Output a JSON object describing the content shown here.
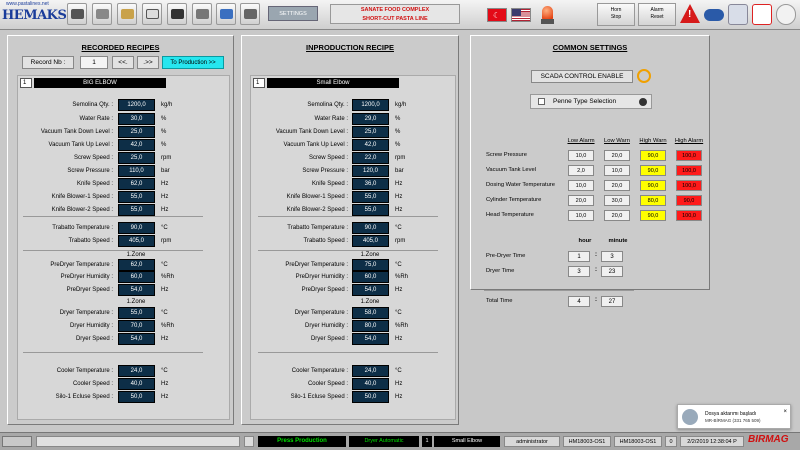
{
  "header": {
    "url": "www.pastalines.net",
    "brand": "HEMAKS",
    "settings_label": "SETTINGS",
    "complex_line1": "SANATE FOOD COMPLEX",
    "complex_line2": "SHORT-CUT PASTA  LINE",
    "horn_label1": "Horn",
    "horn_label2": "Stop",
    "alarm_label1": "Alarm",
    "alarm_label2": "Reset",
    "warn_glyph": "!"
  },
  "recorded": {
    "title": "RECORDED RECIPES",
    "record_label": "Record Nb :",
    "record_value": "1",
    "prev_label": "<<.",
    "next_label": ".>>",
    "to_production": "To Production >>",
    "index": "1",
    "name": "BIG ELBOW",
    "rows": [
      {
        "label": "Semolina Qty. :",
        "value": "1200,0",
        "unit": "kg/h"
      },
      {
        "label": "Water Rate :",
        "value": "30,0",
        "unit": "%"
      },
      {
        "label": "Vacuum Tank Down Level :",
        "value": "25,0",
        "unit": "%"
      },
      {
        "label": "Vacuum Tank Up Level :",
        "value": "42,0",
        "unit": "%"
      },
      {
        "label": "Screw Speed :",
        "value": "25,0",
        "unit": "rpm"
      },
      {
        "label": "Screw Pressure :",
        "value": "110,0",
        "unit": "bar"
      },
      {
        "label": "Knife Speed :",
        "value": "62,0",
        "unit": "Hz"
      },
      {
        "label": "Knife Blower-1 Speed :",
        "value": "55,0",
        "unit": "Hz"
      },
      {
        "label": "Knife Blower-2 Speed :",
        "value": "55,0",
        "unit": "Hz"
      },
      {
        "label": "Trabatto Temperature :",
        "value": "90,0",
        "unit": "°C"
      },
      {
        "label": "Trabatto Speed :",
        "value": "405,0",
        "unit": "rpm"
      },
      {
        "label": "PreDryer Temperature :",
        "value": "62,0",
        "unit": "°C"
      },
      {
        "label": "PreDryer Humidity :",
        "value": "60,0",
        "unit": "%Rh"
      },
      {
        "label": "PreDryer Speed :",
        "value": "54,0",
        "unit": "Hz"
      },
      {
        "label": "Dryer Temperature :",
        "value": "55,0",
        "unit": "°C"
      },
      {
        "label": "Dryer Humidity :",
        "value": "70,0",
        "unit": "%Rh"
      },
      {
        "label": "Dryer Speed :",
        "value": "54,0",
        "unit": "Hz"
      },
      {
        "label": "Cooler Temperature :",
        "value": "24,0",
        "unit": "°C"
      },
      {
        "label": "Cooler Speed :",
        "value": "40,0",
        "unit": "Hz"
      },
      {
        "label": "Silo-1 Ecluse Speed :",
        "value": "50,0",
        "unit": "Hz"
      }
    ],
    "zone1": "1.Zone",
    "zone2": "1.Zone"
  },
  "production": {
    "title": "INPRODUCTION RECIPE",
    "index": "1",
    "name": "Small Elbow",
    "rows": [
      {
        "label": "Semolina Qty. :",
        "value": "1200,0",
        "unit": "kg/h"
      },
      {
        "label": "Water Rate :",
        "value": "29,0",
        "unit": "%"
      },
      {
        "label": "Vacuum Tank Down Level :",
        "value": "25,0",
        "unit": "%"
      },
      {
        "label": "Vacuum Tank Up Level :",
        "value": "42,0",
        "unit": "%"
      },
      {
        "label": "Screw Speed :",
        "value": "22,0",
        "unit": "rpm"
      },
      {
        "label": "Screw Pressure :",
        "value": "120,0",
        "unit": "bar"
      },
      {
        "label": "Knife Speed :",
        "value": "36,0",
        "unit": "Hz"
      },
      {
        "label": "Knife Blower-1 Speed :",
        "value": "55,0",
        "unit": "Hz"
      },
      {
        "label": "Knife Blower-2 Speed :",
        "value": "55,0",
        "unit": "Hz"
      },
      {
        "label": "Trabatto Temperature :",
        "value": "90,0",
        "unit": "°C"
      },
      {
        "label": "Trabatto Speed :",
        "value": "405,0",
        "unit": "rpm"
      },
      {
        "label": "PreDryer Temperature :",
        "value": "75,0",
        "unit": "°C"
      },
      {
        "label": "PreDryer Humidity :",
        "value": "60,0",
        "unit": "%Rh"
      },
      {
        "label": "PreDryer Speed :",
        "value": "54,0",
        "unit": "Hz"
      },
      {
        "label": "Dryer Temperature :",
        "value": "58,0",
        "unit": "°C"
      },
      {
        "label": "Dryer Humidity :",
        "value": "80,0",
        "unit": "%Rh"
      },
      {
        "label": "Dryer Speed :",
        "value": "54,0",
        "unit": "Hz"
      },
      {
        "label": "Cooler Temperature :",
        "value": "24,0",
        "unit": "°C"
      },
      {
        "label": "Cooler Speed :",
        "value": "40,0",
        "unit": "Hz"
      },
      {
        "label": "Silo-1 Ecluse Speed :",
        "value": "50,0",
        "unit": "Hz"
      }
    ],
    "zone1": "1.Zone",
    "zone2": "1.Zone"
  },
  "common": {
    "title": "COMMON SETTINGS",
    "scada_label": "SCADA CONTROL ENABLE",
    "penne_label": "Penne Type Selection",
    "headers": [
      "Low Alarm",
      "Low Warn",
      "High Warn",
      "High Alarm"
    ],
    "rows": [
      {
        "label": "Screw Pressure",
        "values": [
          "10,0",
          "20,0",
          "90,0",
          "100,0"
        ]
      },
      {
        "label": "Vacuum Tank Level",
        "values": [
          "2,0",
          "10,0",
          "90,0",
          "100,0"
        ]
      },
      {
        "label": "Dosing Water Temperature",
        "values": [
          "10,0",
          "20,0",
          "90,0",
          "100,0"
        ]
      },
      {
        "label": "Cylinder Temperature",
        "values": [
          "20,0",
          "30,0",
          "80,0",
          "90,0"
        ]
      },
      {
        "label": "Head Temperature",
        "values": [
          "10,0",
          "20,0",
          "90,0",
          "100,0"
        ]
      }
    ],
    "colors": {
      "low": "#f0f0f0",
      "warn": "#ffff00",
      "alarm": "#ff1a1a"
    },
    "time_hour": "hour",
    "time_minute": "minute",
    "predryer_time": {
      "label": "Pre-Dryer Time",
      "hour": "1",
      "minute": "3"
    },
    "dryer_time": {
      "label": "Dryer Time",
      "hour": "3",
      "minute": "23"
    },
    "total_time": {
      "label": "Total Time",
      "hour": "4",
      "minute": "27"
    }
  },
  "status": {
    "press_production": "Press Production",
    "dryer_automatic": "Dryer Automatic",
    "recipe_index": "1",
    "recipe_name": "Small Elbow",
    "user": "administrator",
    "station1": "HM18003-OS1",
    "station2": "HM18003-OS1",
    "count": "0",
    "datetime": "2/2/2019 12:38:04 P",
    "brand": "BIRMAG"
  },
  "notification": {
    "line1": "Dosya aktarımı başladı",
    "line2": "MR-BİRMAG (331 765 509)",
    "close": "×"
  }
}
